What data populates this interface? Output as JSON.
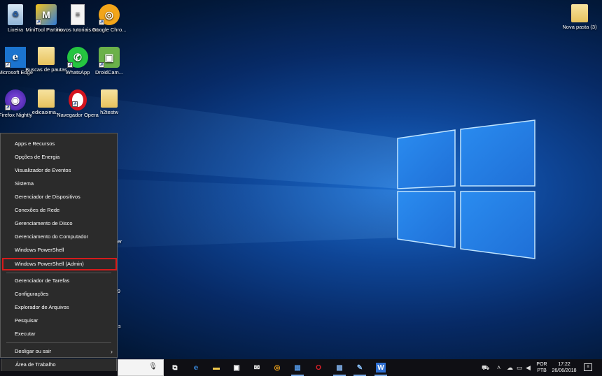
{
  "desktop": {
    "icons": [
      {
        "label": "Lixeira",
        "glyph": "♻"
      },
      {
        "label": "MiniTool Partitio...",
        "glyph": "M"
      },
      {
        "label": "novos tutoriais.txt",
        "glyph": "≡"
      },
      {
        "label": "Google Chro...",
        "glyph": "◎"
      },
      {
        "label": "Nova pasta (3)",
        "glyph": ""
      },
      {
        "label": "Microsoft Edge",
        "glyph": "e"
      },
      {
        "label": "Buscas de pautas",
        "glyph": ""
      },
      {
        "label": "WhatsApp",
        "glyph": "✆"
      },
      {
        "label": "DroidCam...",
        "glyph": "▣"
      },
      {
        "label": "Firefox Nightly",
        "glyph": "◉"
      },
      {
        "label": "edicaoima...",
        "glyph": ""
      },
      {
        "label": "Navegador Opera",
        "glyph": "O"
      },
      {
        "label": "h2testw",
        "glyph": ""
      }
    ],
    "peek_labels": [
      "er",
      "9",
      "s"
    ]
  },
  "context_menu": {
    "group1": [
      "Apps e Recursos",
      "Opções de Energia",
      "Visualizador de Eventos",
      "Sistema",
      "Gerenciador de Dispositivos",
      "Conexões de Rede",
      "Gerenciamento de Disco",
      "Gerenciamento do Computador",
      "Windows PowerShell",
      "Windows PowerShell (Admin)"
    ],
    "group2": [
      "Gerenciador de Tarefas",
      "Configurações",
      "Explorador de Arquivos",
      "Pesquisar",
      "Executar"
    ],
    "group3": [
      "Desligar ou sair",
      "Área de Trabalho"
    ],
    "highlighted": "Windows PowerShell (Admin)",
    "highlight_color": "#d51b1b",
    "submenu_arrow": "›"
  },
  "taskbar": {
    "search_mic": "🎙",
    "apps": [
      {
        "name": "task-view",
        "glyph": "⧉",
        "color": "#ffffff"
      },
      {
        "name": "edge",
        "glyph": "e",
        "color": "#3a8ee6"
      },
      {
        "name": "file-explorer",
        "glyph": "▬",
        "color": "#f2c94c"
      },
      {
        "name": "store",
        "glyph": "▣",
        "color": "#ffffff"
      },
      {
        "name": "mail",
        "glyph": "✉",
        "color": "#ffffff"
      },
      {
        "name": "chrome",
        "glyph": "◎",
        "color": "#f2a51a"
      },
      {
        "name": "app-blue",
        "glyph": "▦",
        "color": "#4f8fd8"
      },
      {
        "name": "opera",
        "glyph": "O",
        "color": "#e0202a"
      },
      {
        "name": "app-monitor",
        "glyph": "▩",
        "color": "#7aa8e0"
      },
      {
        "name": "app-pencil",
        "glyph": "✎",
        "color": "#8cc4ff"
      },
      {
        "name": "word",
        "glyph": "W",
        "color": "#2f6fd1"
      }
    ],
    "tray_icons": [
      "⛟",
      "˄",
      "☁",
      "▭",
      "◀",
      "♪"
    ],
    "language": [
      "POR",
      "PTB"
    ],
    "time": "17:22",
    "date": "26/06/2018",
    "notifications": "≡"
  }
}
